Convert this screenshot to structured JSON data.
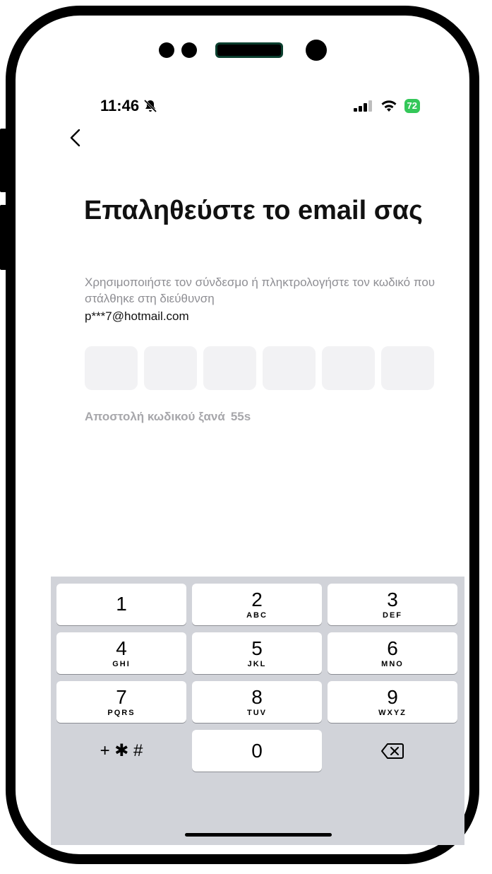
{
  "status_bar": {
    "time": "11:46",
    "battery": "72"
  },
  "screen": {
    "title": "Επαληθεύστε το email σας",
    "description": "Χρησιμοποιήστε τον σύνδεσμο ή πληκτρολογήστε τον κωδικό που στάλθηκε στη διεύθυνση",
    "email": "p***7@hotmail.com",
    "code_boxes": [
      "",
      "",
      "",
      "",
      "",
      ""
    ],
    "resend_label": "Αποστολή κωδικού ξανά",
    "resend_countdown": "55s"
  },
  "keyboard": {
    "keys": [
      {
        "num": "1",
        "letters": ""
      },
      {
        "num": "2",
        "letters": "ABC"
      },
      {
        "num": "3",
        "letters": "DEF"
      },
      {
        "num": "4",
        "letters": "GHI"
      },
      {
        "num": "5",
        "letters": "JKL"
      },
      {
        "num": "6",
        "letters": "MNO"
      },
      {
        "num": "7",
        "letters": "PQRS"
      },
      {
        "num": "8",
        "letters": "TUV"
      },
      {
        "num": "9",
        "letters": "WXYZ"
      }
    ],
    "symbols_label": "+ ✱ #",
    "zero": "0"
  },
  "colors": {
    "battery": "#34c759",
    "keyboard_bg": "#d1d3d9",
    "muted_text": "#8e8e93"
  }
}
